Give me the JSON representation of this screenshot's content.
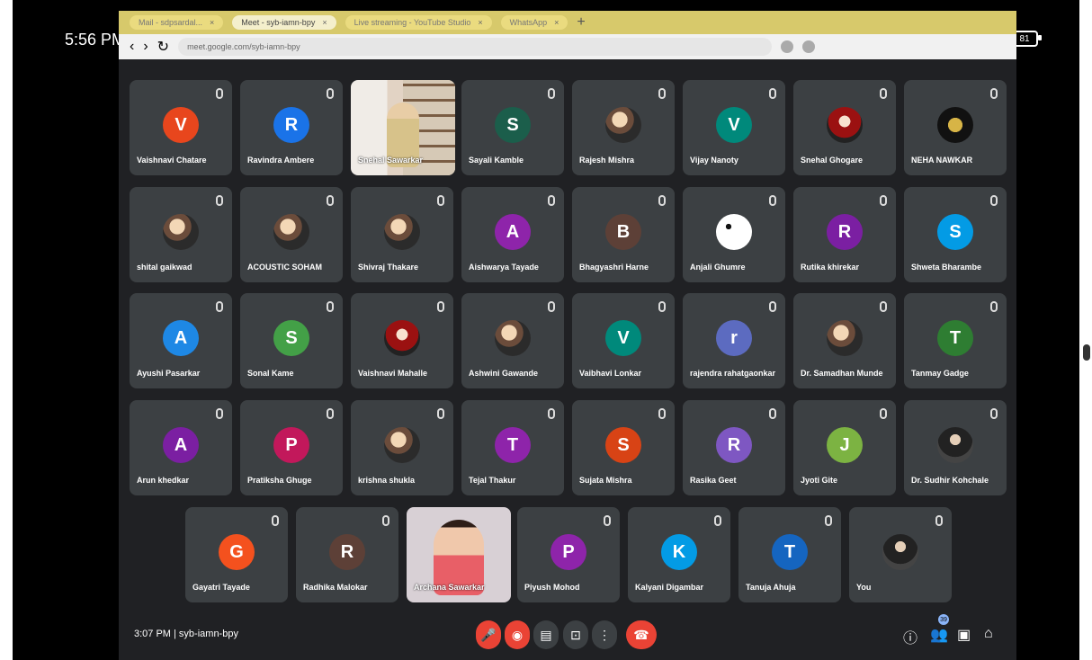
{
  "status": {
    "time": "5:56 PM",
    "battery": "81"
  },
  "browser": {
    "tabs": [
      {
        "label": "Mail - sdpsardal..."
      },
      {
        "label": "Meet - syb-iamn-bpy"
      },
      {
        "label": "Live streaming - YouTube Studio"
      },
      {
        "label": "WhatsApp"
      }
    ],
    "url": "meet.google.com/syb-iamn-bpy"
  },
  "meeting": {
    "time_code": "3:07 PM | syb-iamn-bpy"
  },
  "participants": [
    {
      "name": "Vaishnavi Chatare",
      "initial": "V",
      "color": "#e8461d",
      "type": "letter"
    },
    {
      "name": "Ravindra Ambere",
      "initial": "R",
      "color": "#1a73e8",
      "type": "letter"
    },
    {
      "name": "Snehal Sawarkar",
      "initial": "",
      "color": "",
      "type": "video-room"
    },
    {
      "name": "Sayali Kamble",
      "initial": "S",
      "color": "#1b5e4b",
      "type": "letter"
    },
    {
      "name": "Rajesh Mishra",
      "initial": "",
      "color": "",
      "type": "photo"
    },
    {
      "name": "Vijay Nanoty",
      "initial": "V",
      "color": "#00897b",
      "type": "letter"
    },
    {
      "name": "Snehal Ghogare",
      "initial": "",
      "color": "",
      "type": "photo-red"
    },
    {
      "name": "NEHA NAWKAR",
      "initial": "",
      "color": "",
      "type": "logo"
    },
    {
      "name": "shital gaikwad",
      "initial": "",
      "color": "",
      "type": "photo"
    },
    {
      "name": "ACOUSTIC SOHAM",
      "initial": "",
      "color": "",
      "type": "photo"
    },
    {
      "name": "Shivraj Thakare",
      "initial": "",
      "color": "",
      "type": "photo"
    },
    {
      "name": "Aishwarya Tayade",
      "initial": "A",
      "color": "#8e24aa",
      "type": "letter"
    },
    {
      "name": "Bhagyashri Harne",
      "initial": "B",
      "color": "#5d4037",
      "type": "letter"
    },
    {
      "name": "Anjali Ghumre",
      "initial": "",
      "color": "",
      "type": "panda"
    },
    {
      "name": "Rutika khirekar",
      "initial": "R",
      "color": "#7b1fa2",
      "type": "letter"
    },
    {
      "name": "Shweta Bharambe",
      "initial": "S",
      "color": "#039be5",
      "type": "letter"
    },
    {
      "name": "Ayushi Pasarkar",
      "initial": "A",
      "color": "#1e88e5",
      "type": "letter"
    },
    {
      "name": "Sonal Kame",
      "initial": "S",
      "color": "#43a047",
      "type": "letter"
    },
    {
      "name": "Vaishnavi Mahalle",
      "initial": "",
      "color": "",
      "type": "photo-red"
    },
    {
      "name": "Ashwini Gawande",
      "initial": "",
      "color": "",
      "type": "photo"
    },
    {
      "name": "Vaibhavi Lonkar",
      "initial": "V",
      "color": "#00897b",
      "type": "letter"
    },
    {
      "name": "rajendra rahatgaonkar",
      "initial": "r",
      "color": "#5c6bc0",
      "type": "letter"
    },
    {
      "name": "Dr. Samadhan Munde",
      "initial": "",
      "color": "",
      "type": "photo"
    },
    {
      "name": "Tanmay Gadge",
      "initial": "T",
      "color": "#2e7d32",
      "type": "letter"
    },
    {
      "name": "Arun khedkar",
      "initial": "A",
      "color": "#7b1fa2",
      "type": "letter"
    },
    {
      "name": "Pratiksha Ghuge",
      "initial": "P",
      "color": "#c2185b",
      "type": "letter"
    },
    {
      "name": "krishna shukla",
      "initial": "",
      "color": "",
      "type": "photo"
    },
    {
      "name": "Tejal Thakur",
      "initial": "T",
      "color": "#8e24aa",
      "type": "letter"
    },
    {
      "name": "Sujata Mishra",
      "initial": "S",
      "color": "#d84315",
      "type": "letter"
    },
    {
      "name": "Rasika Geet",
      "initial": "R",
      "color": "#7e57c2",
      "type": "letter"
    },
    {
      "name": "Jyoti Gite",
      "initial": "J",
      "color": "#7cb342",
      "type": "letter"
    },
    {
      "name": "Dr. Sudhir Kohchale",
      "initial": "",
      "color": "",
      "type": "profile"
    },
    {
      "name": "Gayatri Tayade",
      "initial": "G",
      "color": "#f4511e",
      "type": "letter"
    },
    {
      "name": "Radhika Malokar",
      "initial": "R",
      "color": "#5d4037",
      "type": "letter"
    },
    {
      "name": "Archana Sawarkar",
      "initial": "",
      "color": "",
      "type": "video-woman"
    },
    {
      "name": "Piyush Mohod",
      "initial": "P",
      "color": "#8e24aa",
      "type": "letter"
    },
    {
      "name": "Kalyani Digambar",
      "initial": "K",
      "color": "#039be5",
      "type": "letter"
    },
    {
      "name": "Tanuja Ahuja",
      "initial": "T",
      "color": "#1565c0",
      "type": "letter"
    },
    {
      "name": "You",
      "initial": "",
      "color": "",
      "type": "profile"
    }
  ],
  "controls": {
    "people_badge": "39"
  }
}
